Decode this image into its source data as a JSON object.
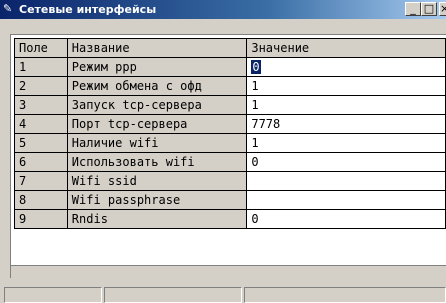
{
  "window": {
    "title": "Сетевые интерфейсы",
    "icon": "app-icon",
    "buttons": {
      "minimize": "_",
      "maximize": "□",
      "close": "×"
    }
  },
  "grid": {
    "columns": [
      "Поле",
      "Название",
      "Значение"
    ],
    "rows": [
      {
        "field": "1",
        "name": "Режим ppp",
        "value": "0",
        "selected": true
      },
      {
        "field": "2",
        "name": "Режим обмена с офд",
        "value": "1"
      },
      {
        "field": "3",
        "name": "Запуск tcp-сервера",
        "value": "1"
      },
      {
        "field": "4",
        "name": "Порт tcp-сервера",
        "value": "7778"
      },
      {
        "field": "5",
        "name": "Наличие wifi",
        "value": "1"
      },
      {
        "field": "6",
        "name": "Использовать wifi",
        "value": "0"
      },
      {
        "field": "7",
        "name": "Wifi ssid",
        "value": ""
      },
      {
        "field": "8",
        "name": "Wifi passphrase",
        "value": ""
      },
      {
        "field": "9",
        "name": "Rndis",
        "value": "0"
      }
    ]
  },
  "colors": {
    "selection": "#0a246a",
    "face": "#d4d0c8",
    "title_start": "#0a246a"
  }
}
